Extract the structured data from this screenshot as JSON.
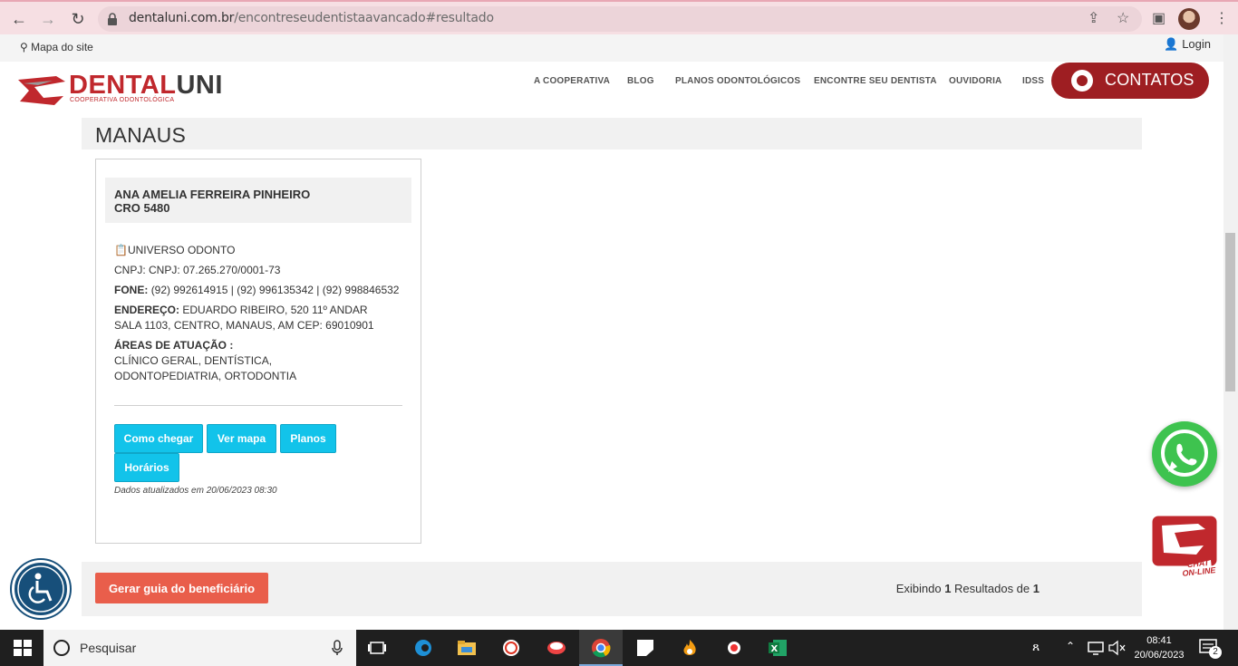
{
  "browser": {
    "url_host": "dentaluni.com.br",
    "url_path": "/encontreseudentistaavancado#resultado"
  },
  "topbar": {
    "sitemap": "Mapa do site",
    "login": "Login"
  },
  "brand": {
    "name_a": "DENTAL",
    "name_b": "UNI",
    "subtitle": "COOPERATIVA ODONTOLÓGICA",
    "accent": "#c0282d"
  },
  "nav": {
    "items": [
      "A COOPERATIVA",
      "BLOG",
      "PLANOS ODONTOLÓGICOS",
      "ENCONTRE SEU DENTISTA",
      "OUVIDORIA",
      "IDSS"
    ],
    "contatos": "CONTATOS"
  },
  "result": {
    "city": "MANAUS",
    "card": {
      "name": "ANA AMELIA FERREIRA PINHEIRO",
      "cro": "CRO 5480",
      "clinic": "UNIVERSO ODONTO",
      "cnpj": "CNPJ: CNPJ: 07.265.270/0001-73",
      "fone_label": "FONE:",
      "fone": "(92) 992614915 | (92) 996135342 | (92) 998846532",
      "endereco_label": "ENDEREÇO:",
      "endereco": "EDUARDO RIBEIRO, 520 11º ANDAR SALA 1103, CENTRO, MANAUS, AM CEP: 69010901",
      "areas_label": "ÁREAS DE ATUAÇÃO :",
      "areas": "CLÍNICO GERAL, DENTÍSTICA, ODONTOPEDIATRIA, ORTODONTIA",
      "buttons": [
        "Como chegar",
        "Ver mapa",
        "Planos",
        "Horários"
      ],
      "updated": "Dados atualizados em 20/06/2023 08:30"
    }
  },
  "footer": {
    "gerar": "Gerar guia do beneficiário",
    "exibindo_a": "Exibindo ",
    "count": "1",
    "exibindo_b": " Resultados de ",
    "total": "1"
  },
  "floating": {
    "chat_line1": "CHAT",
    "chat_line2": "ON-LINE"
  },
  "taskbar": {
    "search": "Pesquisar",
    "time": "08:41",
    "date": "20/06/2023",
    "notif": "2"
  }
}
